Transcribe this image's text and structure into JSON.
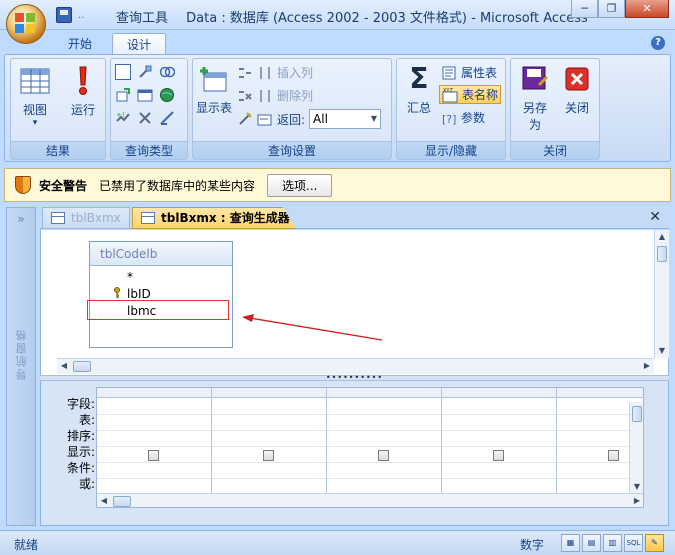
{
  "window": {
    "context_tab": "查询工具",
    "title": "Data : 数据库 (Access 2002 - 2003 文件格式) - Microsoft Access",
    "minimize": "─",
    "restore": "❐",
    "close": "✕"
  },
  "qat": {
    "more": "‥"
  },
  "tabs": {
    "start": "开始",
    "design": "设计",
    "help": "?"
  },
  "ribbon": {
    "results": {
      "label": "结果",
      "view": "视图",
      "view_arrow": "▾",
      "run": "运行"
    },
    "query_type": {
      "label": "查询类型"
    },
    "query_setup": {
      "label": "查询设置",
      "show_table": "显示表",
      "insert_column": "插入列",
      "delete_column": "删除列",
      "return_label": "返回:",
      "return_value": "All"
    },
    "show_hide": {
      "label": "显示/隐藏",
      "totals": "汇总",
      "property_sheet": "属性表",
      "table_names": "表名称",
      "parameters": "参数"
    },
    "close_group": {
      "label": "关闭",
      "save_as_line1": "另存",
      "save_as_line2": "为",
      "close": "关闭"
    }
  },
  "security": {
    "title": "安全警告",
    "message": "已禁用了数据库中的某些内容",
    "options": "选项..."
  },
  "navpane": {
    "chevron": "»",
    "label": "导航窗格"
  },
  "doc_tabs": [
    {
      "label": "tblBxmx"
    },
    {
      "label": "tblBxmx : 查询生成器"
    }
  ],
  "doc_close": "✕",
  "table_box": {
    "name": "tblCodelb",
    "fields": [
      "*",
      "lbID",
      "lbmc"
    ]
  },
  "splitter": "••••••••••",
  "grid": {
    "row_labels": [
      "字段:",
      "表:",
      "排序:",
      "显示:",
      "条件:",
      "或:"
    ],
    "columns": 5
  },
  "status": {
    "left": "就绪",
    "mode": "数字",
    "sql": "SQL"
  },
  "colors": {
    "highlight": "#e8322a",
    "arrow": "#cc1c1c"
  }
}
